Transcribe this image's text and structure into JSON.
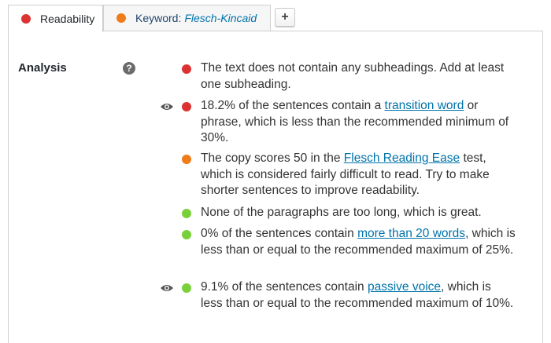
{
  "tabs": {
    "readability": {
      "label": "Readability",
      "dot_color": "#dc3232"
    },
    "keyword": {
      "label": "Keyword:",
      "keyword": "Flesch-Kincaid",
      "dot_color": "#ee7c1b"
    },
    "add_label": "+"
  },
  "analysis": {
    "label": "Analysis",
    "help_icon": "?",
    "colors": {
      "bad": "#dc3232",
      "ok": "#ee7c1b",
      "good": "#7ad03a"
    },
    "results": [
      {
        "status": "bad",
        "eye": false,
        "text": "The text does not contain any subheadings. Add at least one subheading."
      },
      {
        "status": "bad",
        "eye": true,
        "pre": "18.2% of the sentences contain a ",
        "link": "transition word",
        "post": " or phrase, which is less than the recommended minimum of 30%."
      },
      {
        "status": "ok",
        "eye": false,
        "pre": "The copy scores 50 in the ",
        "link": "Flesch Reading Ease",
        "post": " test, which is considered fairly difficult to read. Try to make shorter sentences to improve readability."
      },
      {
        "status": "good",
        "eye": false,
        "text": "None of the paragraphs are too long, which is great."
      },
      {
        "status": "good",
        "eye": false,
        "pre": "0% of the sentences contain ",
        "link": "more than 20 words",
        "post": ", which is less than or equal to the recommended maximum of 25%."
      },
      {
        "status": "good",
        "eye": true,
        "pre": "9.1% of the sentences contain ",
        "link": "passive voice",
        "post": ", which is less than or equal to the recommended maximum of 10%."
      }
    ]
  }
}
